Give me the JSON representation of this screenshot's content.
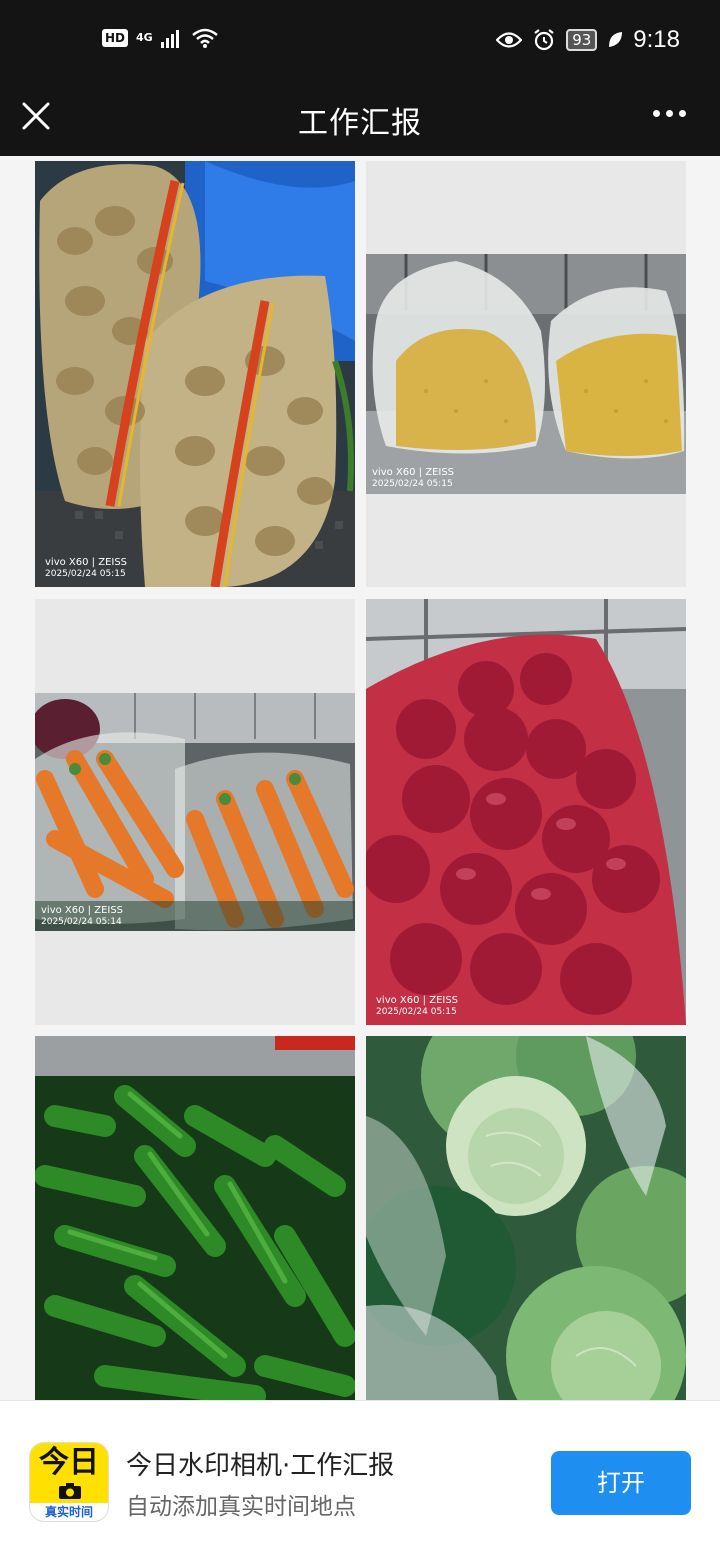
{
  "status_bar": {
    "hd_badge": "HD",
    "network": "4G",
    "battery": "93",
    "time": "9:18",
    "icons": [
      "signal-icon",
      "wifi-icon",
      "eye-icon",
      "alarm-icon",
      "leaf-icon"
    ]
  },
  "nav": {
    "title": "工作汇报",
    "close_icon": "close-icon",
    "more_icon": "more-icon"
  },
  "photos": [
    {
      "subject": "potatoes",
      "watermark_brand": "vivo X60 | ZEISS",
      "watermark_time": "2025/02/24 05:15"
    },
    {
      "subject": "corn-kernels",
      "watermark_brand": "vivo X60 | ZEISS",
      "watermark_time": "2025/02/24 05:15"
    },
    {
      "subject": "carrots",
      "watermark_brand": "vivo X60 | ZEISS",
      "watermark_time": "2025/02/24 05:14"
    },
    {
      "subject": "red-onions",
      "watermark_brand": "vivo X60 | ZEISS",
      "watermark_time": "2025/02/24 05:15"
    },
    {
      "subject": "green-peppers"
    },
    {
      "subject": "cabbages"
    }
  ],
  "banner": {
    "logo_top": "今日",
    "logo_bottom": "真实时间",
    "app_name": "今日水印相机·工作汇报",
    "app_sub": "自动添加真实时间地点",
    "open_button": "打开"
  },
  "colors": {
    "bar_bg": "#141414",
    "button_blue": "#1f8ef1",
    "logo_yellow": "#ffe000"
  }
}
